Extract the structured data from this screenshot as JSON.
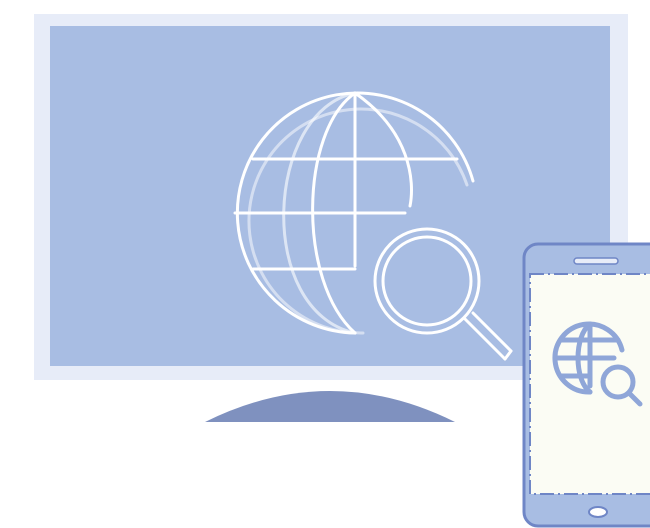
{
  "illustration": {
    "monitor_icon": "globe-search-icon",
    "phone_icon": "globe-search-icon",
    "stand_icon": "monitor-stand",
    "colors": {
      "background": "#ffffff",
      "monitor_frame": "#e7ecf8",
      "monitor_screen": "#a8bde3",
      "stand": "#7f91bf",
      "phone_body": "#a8bde3",
      "phone_outline": "#6f86c6",
      "phone_screen": "#fbfcf4",
      "globe_stroke_monitor": "#ffffff",
      "globe_stroke_phone": "#8fa6d8"
    }
  }
}
